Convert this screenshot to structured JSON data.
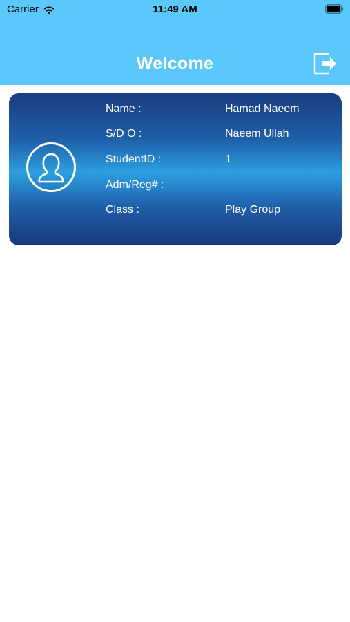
{
  "status_bar": {
    "carrier": "Carrier",
    "time": "11:49 AM",
    "wifi_icon": "wifi-icon",
    "battery_icon": "battery-icon"
  },
  "header": {
    "title": "Welcome",
    "logout_icon": "logout-icon",
    "background_color": "#5ac8fa"
  },
  "student_card": {
    "avatar_icon": "user-avatar-icon",
    "rows": [
      {
        "label": "Name :",
        "value": "Hamad Naeem"
      },
      {
        "label": "S/D O :",
        "value": "Naeem Ullah"
      },
      {
        "label": "StudentID :",
        "value": "1"
      },
      {
        "label": "Adm/Reg# :",
        "value": ""
      },
      {
        "label": "Class :",
        "value": "Play Group"
      }
    ],
    "gradient_colors": [
      "#1a3e7e",
      "#2c9fe0",
      "#193878"
    ]
  }
}
